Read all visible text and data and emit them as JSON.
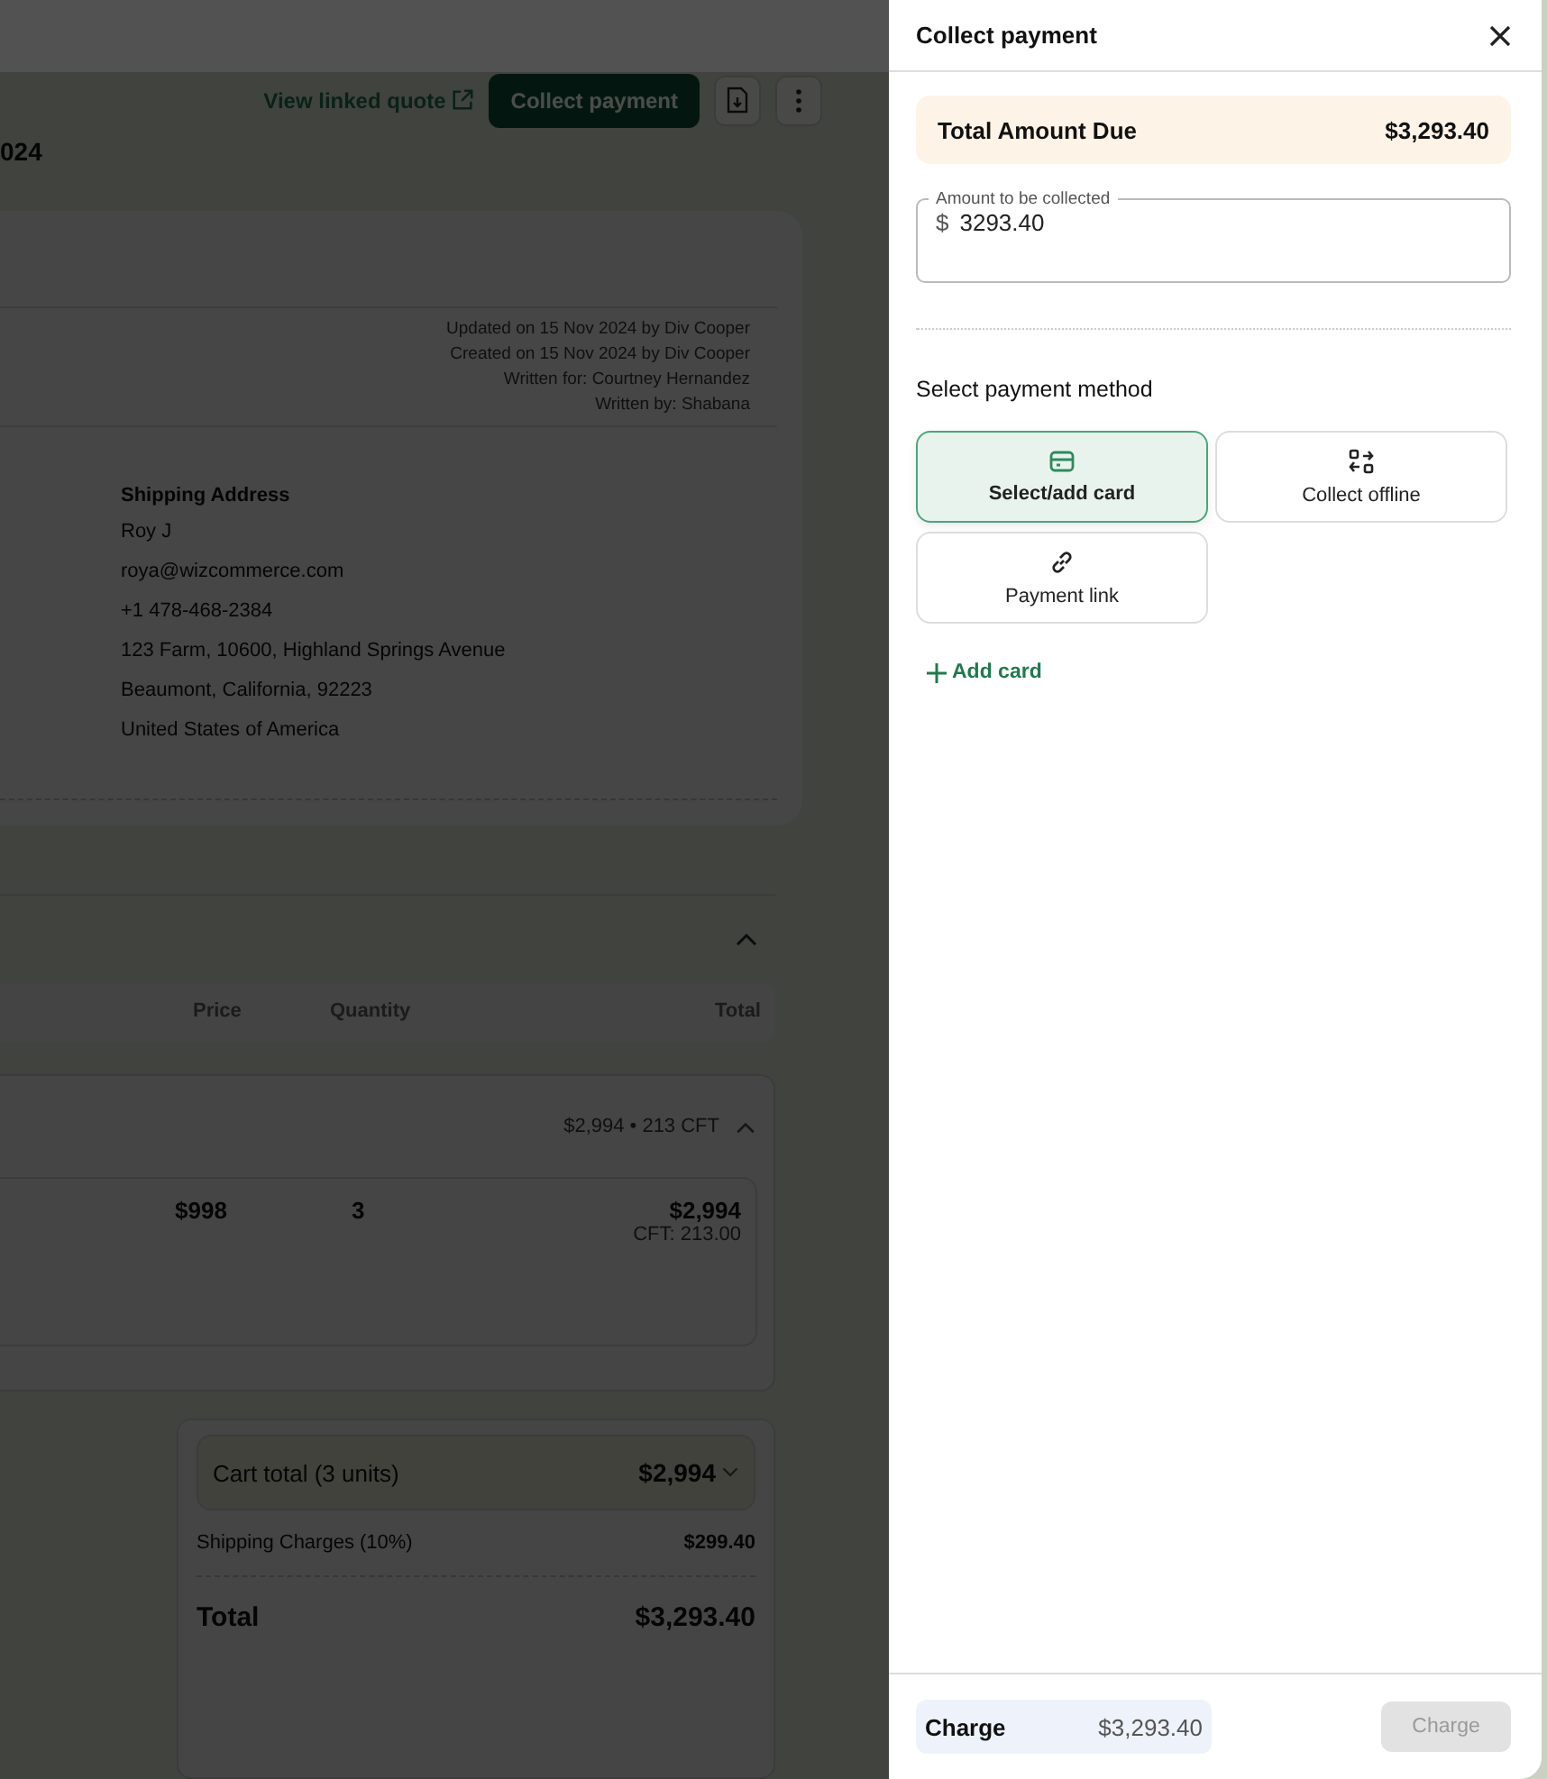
{
  "page": {
    "actions": {
      "link": "View linked quote",
      "primary": "Collect payment"
    },
    "title_fragment": "024",
    "meta": [
      "Updated on 15 Nov 2024 by Div Cooper",
      "Created on 15 Nov 2024 by Div Cooper",
      "Written for: Courtney Hernandez",
      "Written by: Shabana"
    ],
    "shipping_address": {
      "heading": "Shipping Address",
      "lines": [
        "Roy J",
        "roya@wizcommerce.com",
        "+1 478-468-2384",
        "123 Farm, 10600, Highland Springs Avenue",
        "Beaumont, California, 92223",
        "United States of America"
      ]
    },
    "section": {
      "expanded": true
    },
    "table": {
      "columns": [
        "Price",
        "Quantity",
        "Total"
      ],
      "group": {
        "summary": "$2,994 • 213 CFT",
        "expanded": true,
        "items": [
          {
            "price": "$998",
            "quantity": "3",
            "total": "$2,994",
            "cft": "CFT: 213.00"
          }
        ]
      }
    },
    "summary": {
      "cart_total": {
        "label": "Cart total (3 units)",
        "amount": "$2,994",
        "expanded": false
      },
      "rows": [
        {
          "kind": "charge",
          "label": "Shipping Charges (10%)",
          "amount": "$299.40"
        },
        {
          "kind": "total",
          "label": "Total",
          "amount": "$3,293.40"
        }
      ]
    }
  },
  "drawer": {
    "title": "Collect payment",
    "total_due": {
      "label": "Total Amount Due",
      "amount": "$3,293.40"
    },
    "amount_field": {
      "label": "Amount to be collected",
      "prefix": "$",
      "value": "3293.40"
    },
    "method_heading": "Select payment method",
    "options": [
      {
        "kind": "card",
        "label": "Select/add card",
        "selected": true
      },
      {
        "kind": "offline",
        "label": "Collect offline",
        "selected": false
      },
      {
        "kind": "link",
        "label": "Payment link",
        "selected": false
      }
    ],
    "add_card": "Add card",
    "footer": {
      "label": "Charge",
      "amount": "$3,293.40"
    },
    "charge_button": {
      "label": "Charge",
      "disabled": true
    }
  }
}
